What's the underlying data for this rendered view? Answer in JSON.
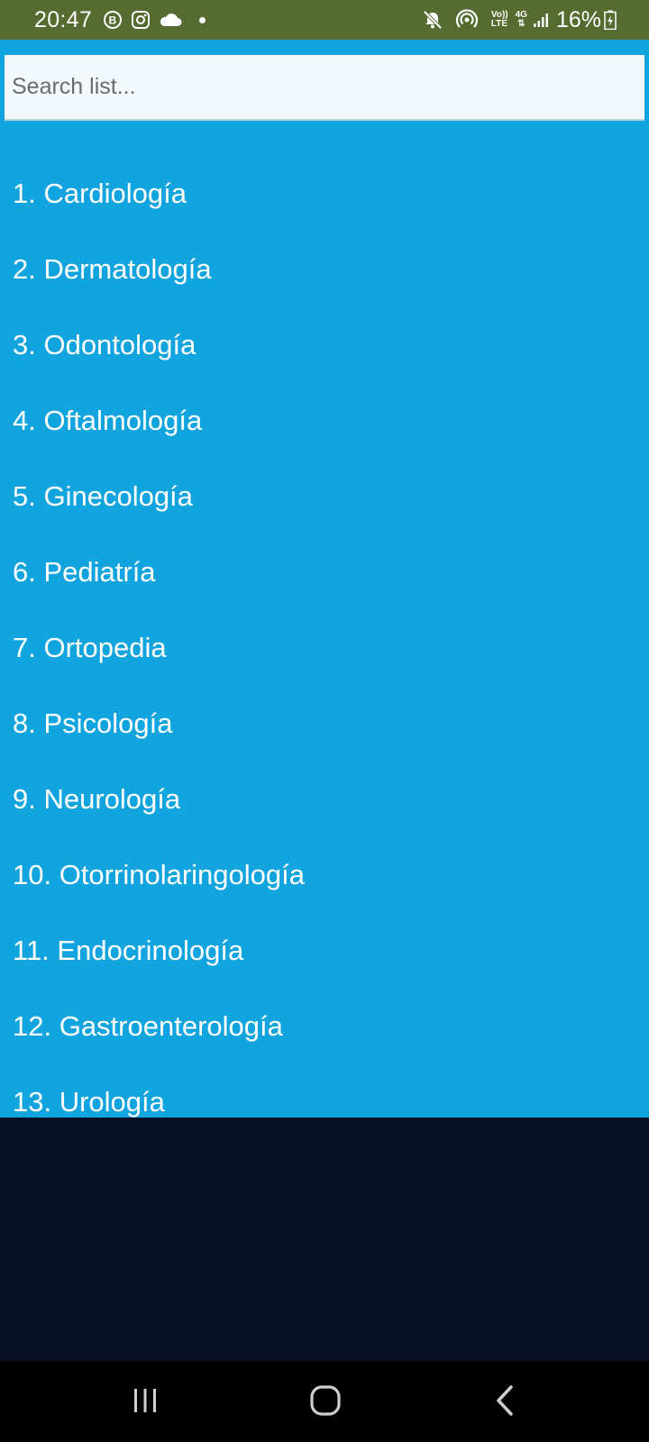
{
  "status_bar": {
    "time": "20:47",
    "lte_top": "Vo))",
    "lte_bottom": "LTE",
    "net_top": "4G",
    "net_bottom": "⇅",
    "battery": "16%",
    "icons": [
      "b-circle-icon",
      "instagram-icon",
      "cloud-icon",
      "dot-icon",
      "mute-icon",
      "hotspot-icon",
      "signal-icon",
      "battery-icon"
    ]
  },
  "search": {
    "placeholder": "Search list..."
  },
  "specialties": [
    "1. Cardiología",
    "2. Dermatología",
    "3. Odontología",
    "4. Oftalmología",
    "5. Ginecología",
    "6. Pediatría",
    "7. Ortopedia",
    "8. Psicología",
    "9. Neurología",
    "10. Otorrinolaringología",
    "11. Endocrinología",
    "12. Gastroenterología",
    "13. Urología"
  ],
  "colors": {
    "status_bar": "#556b2f",
    "list_background": "#12a4df",
    "empty_background": "#0b1029",
    "nav_bar": "#000000"
  }
}
